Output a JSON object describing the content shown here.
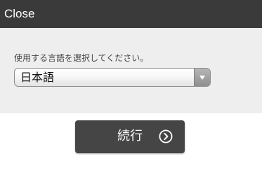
{
  "header": {
    "close_label": "Close",
    "background_color": "#3a3a3a"
  },
  "language_panel": {
    "prompt": "使用する言語を選択してください。",
    "selected_language": "日本語",
    "background_color": "#eeeeee"
  },
  "continue_button": {
    "label": "続行",
    "icon": "chevron-right-circle-icon",
    "background_color": "#454545"
  }
}
